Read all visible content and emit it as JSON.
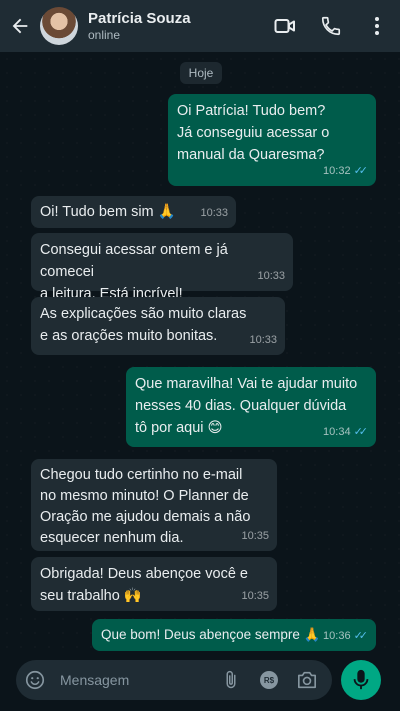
{
  "contact": {
    "name": "Patrícia Souza",
    "status": "online"
  },
  "chat": {
    "date_label": "Hoje",
    "messages": [
      {
        "direction": "out",
        "text": "Oi Patrícia! Tudo bem?\nJá conseguiu acessar o\nmanual da Quaresma?",
        "time": "10:32",
        "read": true
      },
      {
        "direction": "in",
        "text": "Oi! Tudo bem sim 🙏",
        "time": "10:33"
      },
      {
        "direction": "in",
        "text": "Consegui acessar ontem e já comecei\na leitura. Está incrível!",
        "time": "10:33"
      },
      {
        "direction": "in",
        "text": "As explicações são muito claras\ne as orações muito bonitas.",
        "time": "10:33"
      },
      {
        "direction": "out",
        "text": "Que maravilha! Vai te ajudar muito\nnesses 40 dias. Qualquer dúvida\ntô por aqui 😊",
        "time": "10:34",
        "read": true
      },
      {
        "direction": "in",
        "text": "Chegou tudo certinho no e-mail\nno mesmo minuto! O Planner de\nOração me ajudou demais a não\nesquecer nenhum dia.",
        "time": "10:35"
      },
      {
        "direction": "in",
        "text": "Obrigada! Deus abençoe você e\nseu trabalho 🙌",
        "time": "10:35"
      },
      {
        "direction": "out",
        "text": "Que bom! Deus abençoe sempre 🙏",
        "time": "10:36",
        "read": true
      }
    ]
  },
  "composer": {
    "placeholder": "Mensagem",
    "currency_icon_label": "R$"
  },
  "colors": {
    "header": "#1f2c34",
    "background": "#0b141a",
    "incoming": "#202c33",
    "outgoing": "#005c4b",
    "accent": "#00a884",
    "read_ticks": "#53bdeb"
  },
  "icons": [
    "back-arrow-icon",
    "video-call-icon",
    "phone-icon",
    "more-options-icon",
    "emoji-icon",
    "attach-icon",
    "payment-icon",
    "camera-icon",
    "mic-icon",
    "read-ticks-icon"
  ]
}
